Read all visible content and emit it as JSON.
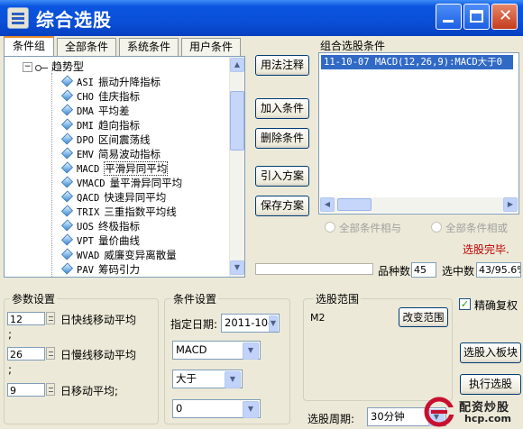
{
  "window": {
    "title": "综合选股"
  },
  "tabs": [
    "条件组",
    "全部条件",
    "系统条件",
    "用户条件"
  ],
  "tree": {
    "root": "趋势型",
    "root_toggle": "−",
    "items": [
      {
        "code": "ASI",
        "name": "振动升降指标"
      },
      {
        "code": "CHO",
        "name": "佳庆指标"
      },
      {
        "code": "DMA",
        "name": "平均差"
      },
      {
        "code": "DMI",
        "name": "趋向指标"
      },
      {
        "code": "DPO",
        "name": "区间震荡线"
      },
      {
        "code": "EMV",
        "name": "简易波动指标"
      },
      {
        "code": "MACD",
        "name": "平滑异同平均"
      },
      {
        "code": "VMACD",
        "name": "量平滑异同平均"
      },
      {
        "code": "QACD",
        "name": "快速异同平均"
      },
      {
        "code": "TRIX",
        "name": "三重指数平均线"
      },
      {
        "code": "UOS",
        "name": "终极指标"
      },
      {
        "code": "VPT",
        "name": "量价曲线"
      },
      {
        "code": "WVAD",
        "name": "威廉变异离散量"
      },
      {
        "code": "PAV",
        "name": "筹码引力"
      }
    ],
    "selected_index": 6
  },
  "buttons": {
    "usage": "用法注释",
    "add": "加入条件",
    "delete": "删除条件",
    "import": "引入方案",
    "save": "保存方案",
    "change_range": "改变范围",
    "add_to_board": "选股入板块",
    "execute": "执行选股"
  },
  "combo": {
    "label": "组合选股条件",
    "items": [
      "11-10-07 MACD(12,26,9):MACD大于0"
    ]
  },
  "logic": {
    "and": "全部条件相与",
    "or": "全部条件相或"
  },
  "status": "选股完毕.",
  "counts": {
    "stock_count_label": "品种数",
    "stock_count": "45",
    "selected_label": "选中数",
    "selected": "43/95.6%"
  },
  "params": {
    "title": "参数设置",
    "rows": [
      {
        "value": "12",
        "label": "日快线移动平均",
        "sep": ";"
      },
      {
        "value": "26",
        "label": "日慢线移动平均",
        "sep": ";"
      },
      {
        "value": "9",
        "label": "日移动平均;"
      }
    ]
  },
  "condition": {
    "title": "条件设置",
    "date_label": "指定日期:",
    "date_value": "2011-10-",
    "indicator": "MACD",
    "operator": "大于",
    "value": "0"
  },
  "range": {
    "title": "选股范围",
    "value": "M2",
    "period_label": "选股周期:",
    "period_value": "30分钟"
  },
  "options": {
    "exact_restore": "精确复权",
    "exact_restore_checked": true
  },
  "watermark": {
    "title": "配资炒股",
    "site": "hcp.com"
  },
  "colors": {
    "titlebar": "#0a4fd8",
    "selection": "#316ac5",
    "status": "#c00000",
    "face": "#ece9d8"
  }
}
